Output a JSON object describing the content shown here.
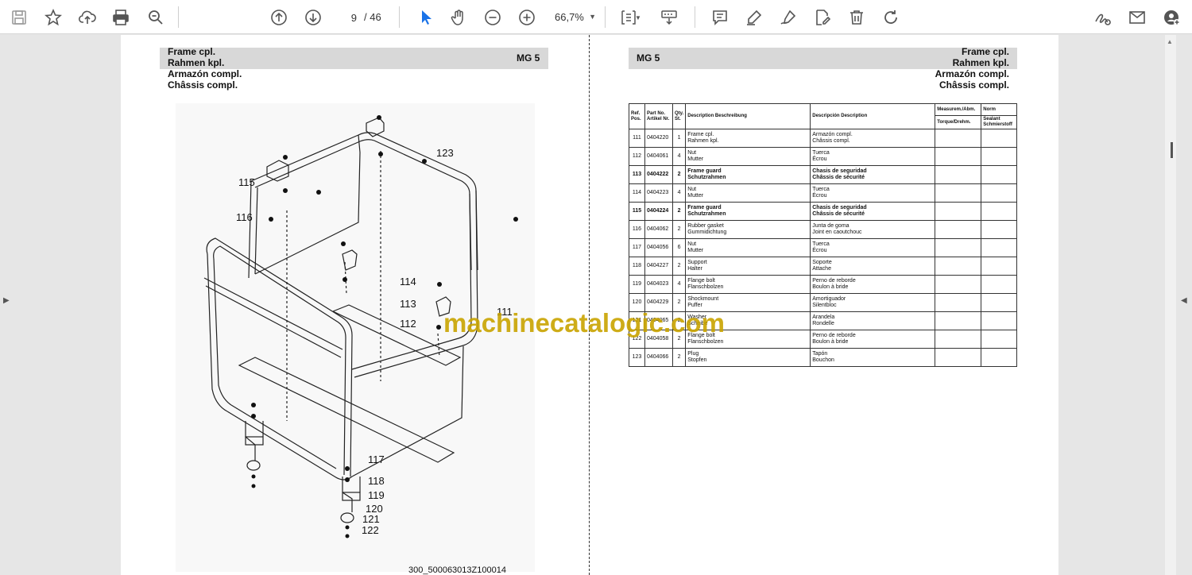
{
  "toolbar": {
    "page_current": "9",
    "page_total": "/ 46",
    "zoom": "66,7%"
  },
  "page": {
    "left_header": [
      "Frame cpl.",
      "Rahmen kpl.",
      "Armazón compl.",
      "Châssis compl."
    ],
    "model_left": "MG 5",
    "model_right": "MG 5",
    "right_header": [
      "Frame cpl.",
      "Rahmen kpl.",
      "Armazón compl.",
      "Châssis compl."
    ],
    "footer": "300_500063013Z100014",
    "watermark": "machinecatalogic.com"
  },
  "callouts": [
    "115",
    "116",
    "123",
    "114",
    "113",
    "112",
    "111",
    "117",
    "118",
    "119",
    "120",
    "121",
    "122"
  ],
  "table": {
    "headers": {
      "ref": "Ref. Pos.",
      "part": "Part No. Artikel Nr.",
      "qty": "Qty. St.",
      "desc": "Description Beschreibung",
      "desc2": "Descripción Description",
      "meas_top": "Measurem./Abm.",
      "meas_bottom": "Torque/Drehm.",
      "norm_top": "Norm",
      "norm_bottom": "Sealant Schmierstoff"
    },
    "rows": [
      {
        "ref": "111",
        "part": "0404220",
        "qty": "1",
        "d1": "Frame cpl.",
        "d2": "Rahmen kpl.",
        "e1": "Armazón compl.",
        "e2": "Châssis compl.",
        "bold": false
      },
      {
        "ref": "112",
        "part": "0404061",
        "qty": "4",
        "d1": "Nut",
        "d2": "Mutter",
        "e1": "Tuerca",
        "e2": "Écrou",
        "bold": false
      },
      {
        "ref": "113",
        "part": "0404222",
        "qty": "2",
        "d1": "Frame guard",
        "d2": "Schutzrahmen",
        "e1": "Chasis de seguridad",
        "e2": "Châssis de sécurité",
        "bold": true
      },
      {
        "ref": "114",
        "part": "0404223",
        "qty": "4",
        "d1": "Nut",
        "d2": "Mutter",
        "e1": "Tuerca",
        "e2": "Écrou",
        "bold": false
      },
      {
        "ref": "115",
        "part": "0404224",
        "qty": "2",
        "d1": "Frame guard",
        "d2": "Schutzrahmen",
        "e1": "Chasis de seguridad",
        "e2": "Châssis de sécurité",
        "bold": true
      },
      {
        "ref": "116",
        "part": "0404062",
        "qty": "2",
        "d1": "Rubber gasket",
        "d2": "Gummidichtung",
        "e1": "Junta de goma",
        "e2": "Joint en caoutchouc",
        "bold": false
      },
      {
        "ref": "117",
        "part": "0404056",
        "qty": "6",
        "d1": "Nut",
        "d2": "Mutter",
        "e1": "Tuerca",
        "e2": "Écrou",
        "bold": false
      },
      {
        "ref": "118",
        "part": "0404227",
        "qty": "2",
        "d1": "Support",
        "d2": "Halter",
        "e1": "Soporte",
        "e2": "Attache",
        "bold": false
      },
      {
        "ref": "119",
        "part": "0404023",
        "qty": "4",
        "d1": "Flange bolt",
        "d2": "Flanschbolzen",
        "e1": "Perno de reborde",
        "e2": "Boulon à bride",
        "bold": false
      },
      {
        "ref": "120",
        "part": "0404229",
        "qty": "2",
        "d1": "Shockmount",
        "d2": "Puffer",
        "e1": "Amortiguador",
        "e2": "Silentbloc",
        "bold": false
      },
      {
        "ref": "121",
        "part": "0404065",
        "qty": "2",
        "d1": "Washer",
        "d2": "Scheibe",
        "e1": "Arandela",
        "e2": "Rondelle",
        "bold": false
      },
      {
        "ref": "122",
        "part": "0404058",
        "qty": "2",
        "d1": "Flange bolt",
        "d2": "Flanschbolzen",
        "e1": "Perno de reborde",
        "e2": "Boulon à bride",
        "bold": false
      },
      {
        "ref": "123",
        "part": "0404066",
        "qty": "2",
        "d1": "Plug",
        "d2": "Stopfen",
        "e1": "Tapón",
        "e2": "Bouchon",
        "bold": false
      }
    ]
  }
}
